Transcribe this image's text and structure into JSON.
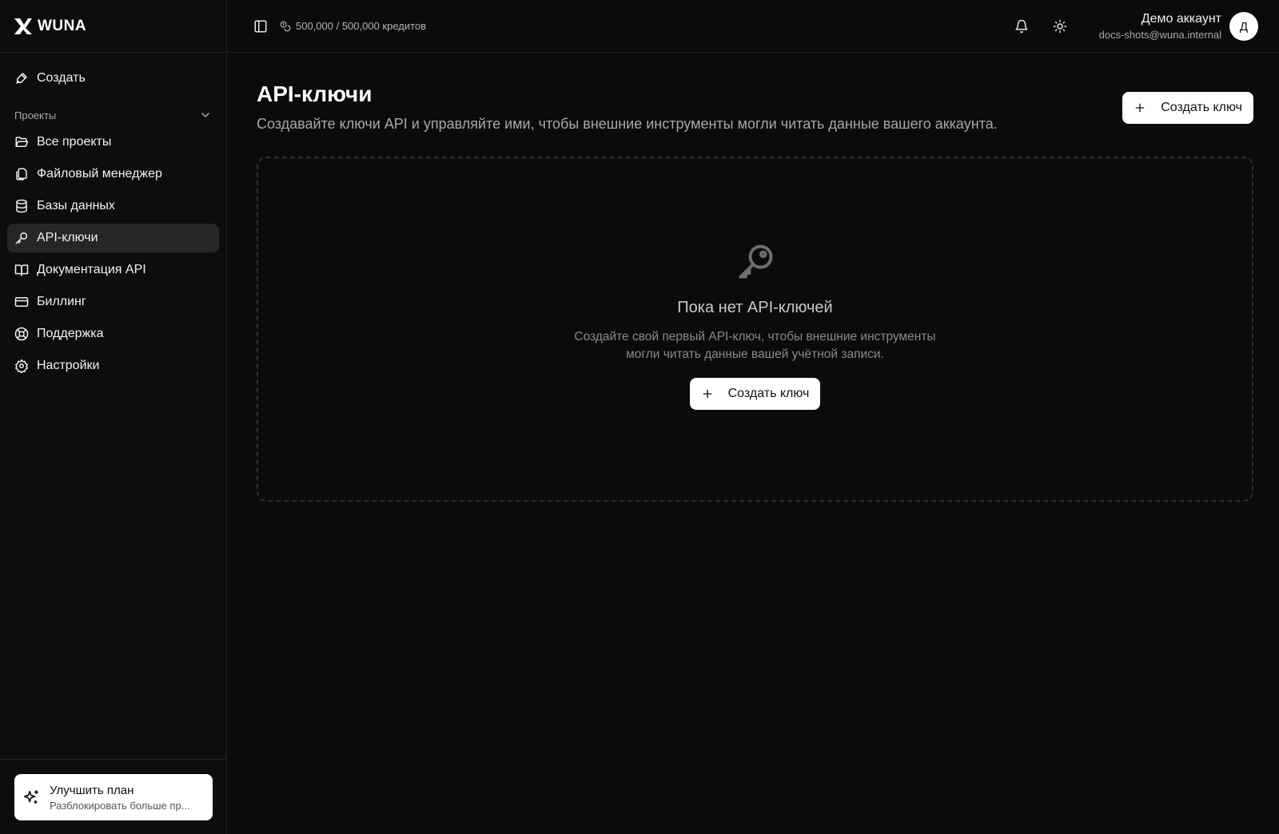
{
  "brand": {
    "name": "WUNA"
  },
  "sidebar": {
    "create_label": "Создать",
    "section_label": "Проекты",
    "items": [
      {
        "label": "Все проекты",
        "icon": "folder-open-icon"
      },
      {
        "label": "Файловый менеджер",
        "icon": "files-icon"
      },
      {
        "label": "Базы данных",
        "icon": "database-icon"
      },
      {
        "label": "API-ключи",
        "icon": "key-icon",
        "active": true
      },
      {
        "label": "Документация API",
        "icon": "book-open-icon"
      },
      {
        "label": "Биллинг",
        "icon": "credit-card-icon"
      },
      {
        "label": "Поддержка",
        "icon": "life-buoy-icon"
      },
      {
        "label": "Настройки",
        "icon": "settings-icon"
      }
    ],
    "upgrade": {
      "title": "Улучшить план",
      "subtitle": "Разблокировать больше пр..."
    }
  },
  "topbar": {
    "credits": "500,000 / 500,000 кредитов",
    "account_name": "Демо аккаунт",
    "account_email": "docs-shots@wuna.internal",
    "avatar_initial": "Д"
  },
  "main": {
    "title": "API-ключи",
    "subtitle": "Создавайте ключи API и управляйте ими, чтобы внешние инструменты могли читать данные вашего аккаунта.",
    "create_button": "Создать ключ",
    "empty": {
      "title": "Пока нет API-ключей",
      "text_line1": "Создайте свой первый API-ключ, чтобы внешние инструменты",
      "text_line2": "могли читать данные вашей учётной записи.",
      "button": "Создать ключ"
    }
  },
  "colors": {
    "background": "#0b0b0b",
    "active_item": "#262626",
    "button": "#ffffff"
  }
}
